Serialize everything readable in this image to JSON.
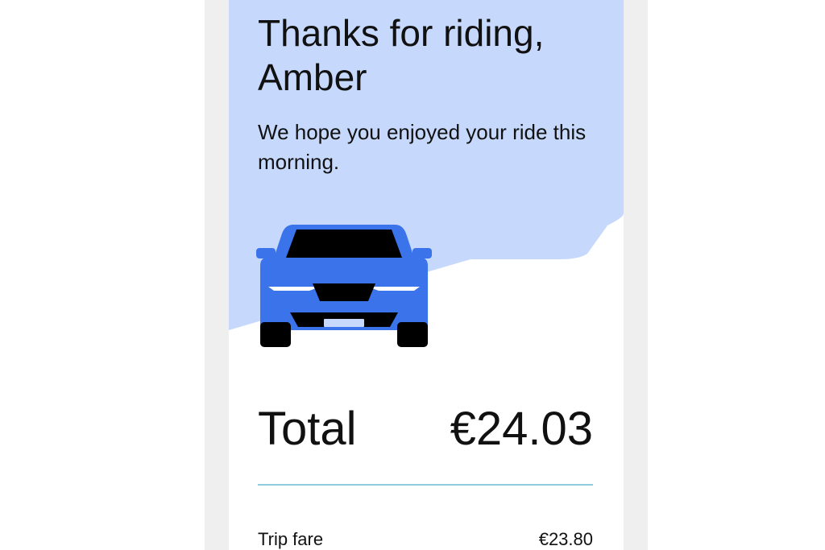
{
  "colors": {
    "hero_background": "#c6d8fb",
    "car_body": "#3b74ea",
    "car_dark": "#000000",
    "divider": "#8fcadd",
    "side_frame": "#efefef"
  },
  "receipt": {
    "greeting": "Thanks for riding, Amber",
    "message": "We hope you enjoyed your ride this morning.",
    "illustration": "car-front-icon",
    "total_label": "Total",
    "total_value": "€24.03",
    "line_items": [
      {
        "label": "Trip fare",
        "value": "€23.80"
      }
    ]
  }
}
